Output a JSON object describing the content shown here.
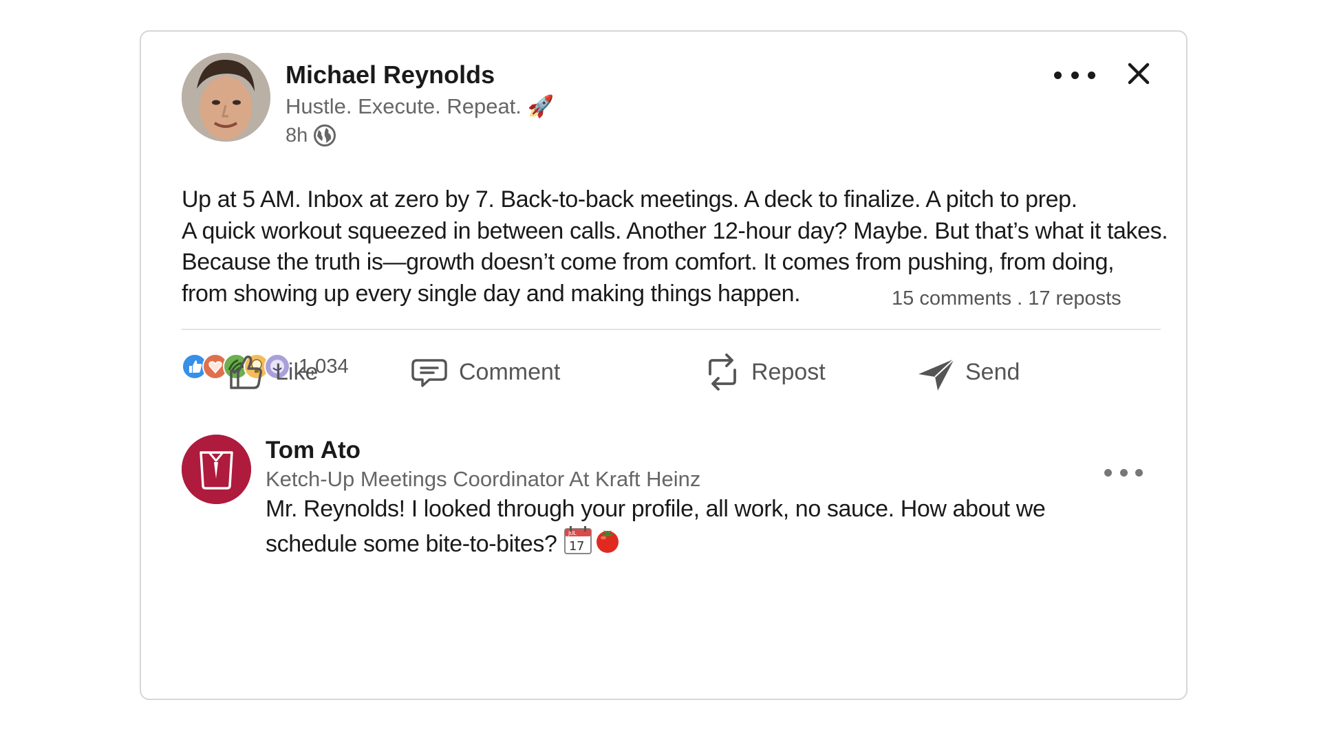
{
  "post": {
    "author_name": "Michael Reynolds",
    "author_headline": "Hustle. Execute. Repeat. 🚀",
    "time": "8h",
    "body_lines": [
      "Up at 5 AM. Inbox at zero by 7. Back-to-back meetings. A deck to finalize. A pitch to prep.",
      "A quick workout squeezed in between calls. Another 12-hour day? Maybe. But that’s what it takes.",
      "Because the truth is—growth doesn’t come from comfort. It comes from pushing, from doing,",
      "from showing up every single day and making things happen."
    ],
    "reaction_count": "1,034",
    "stats": "15 comments . 17 reposts",
    "reactions": [
      "like-icon",
      "love-icon",
      "support-icon",
      "insightful-icon",
      "funny-icon"
    ]
  },
  "actions": {
    "like": "Like",
    "comment": "Comment",
    "repost": "Repost",
    "send": "Send"
  },
  "comment": {
    "author_name": "Tom Ato",
    "author_headline": "Ketch-Up Meetings Coordinator At Kraft Heinz",
    "body_line1": "Mr. Reynolds! I looked through your profile, all work, no sauce. How about we",
    "body_line2": "schedule some bite-to-bites?",
    "calendar_month": "JUL",
    "calendar_day": "17"
  },
  "colors": {
    "comment_avatar": "#ae1b3d",
    "like_reaction": "#378fe9",
    "love_reaction": "#df704d",
    "support_reaction": "#6dae4f",
    "insightful_reaction": "#f5bb5c",
    "funny_reaction": "#a8a0d8"
  }
}
